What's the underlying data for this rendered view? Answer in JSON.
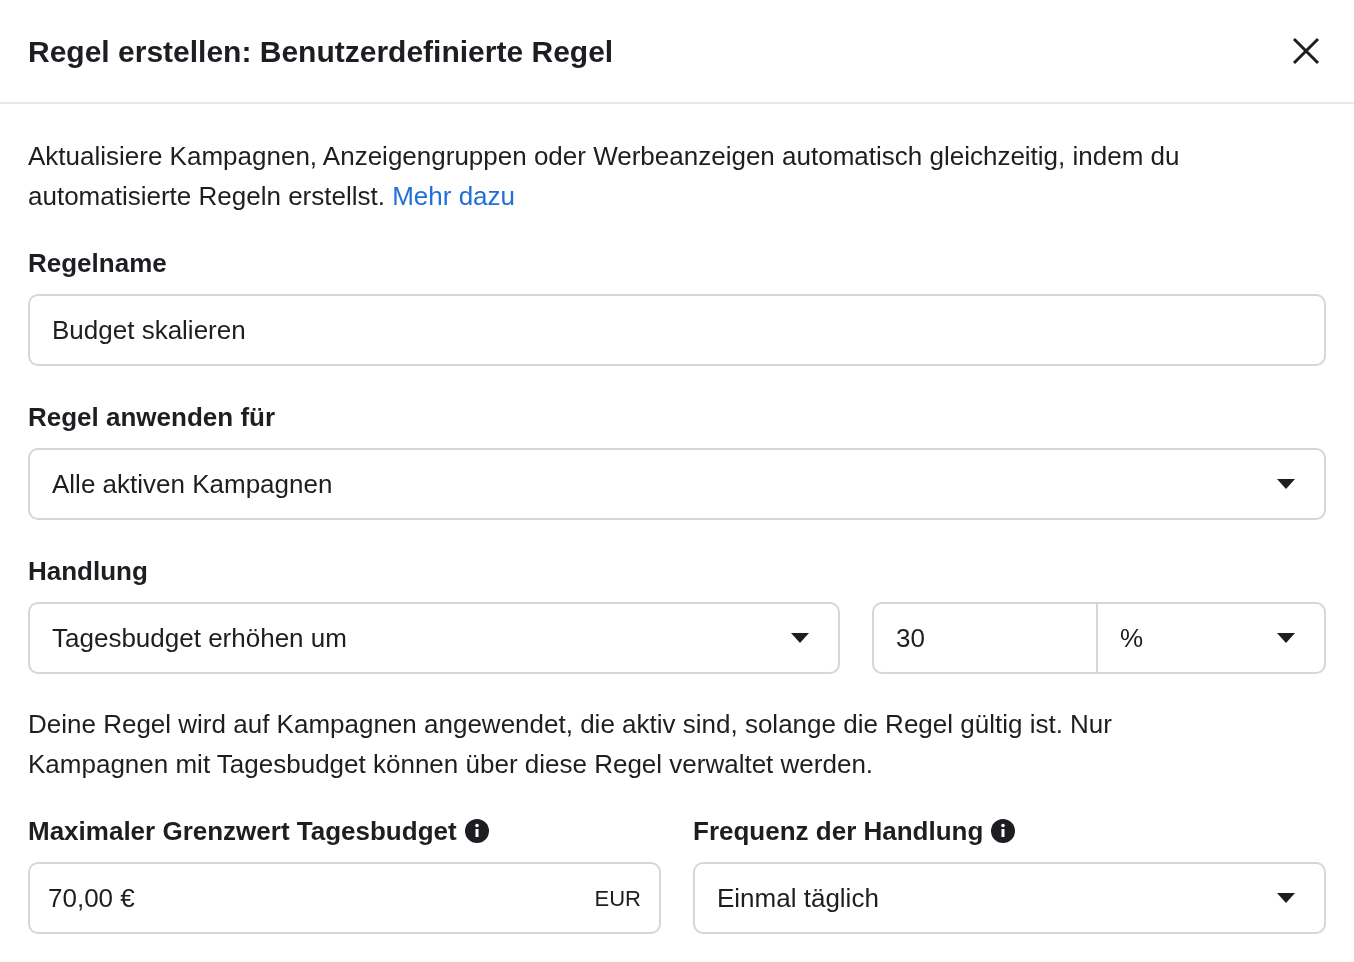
{
  "dialog": {
    "title": "Regel erstellen: Benutzerdefinierte Regel"
  },
  "intro": {
    "text": "Aktualisiere Kampagnen, Anzeigengruppen oder Werbeanzeigen automatisch gleichzeitig, indem du automatisierte Regeln erstellst.",
    "link": "Mehr dazu"
  },
  "rule_name": {
    "label": "Regelname",
    "value": "Budget skalieren"
  },
  "apply_to": {
    "label": "Regel anwenden für",
    "value": "Alle aktiven Kampagnen"
  },
  "action": {
    "label": "Handlung",
    "value": "Tagesbudget erhöhen um",
    "amount": "30",
    "unit": "%"
  },
  "note": "Deine Regel wird auf Kampagnen angewendet, die aktiv sind, solange die Regel gültig ist. Nur Kampagnen mit Tagesbudget können über diese Regel verwaltet werden.",
  "max_budget": {
    "label": "Maximaler Grenzwert Tagesbudget",
    "value": "70,00 €",
    "currency": "EUR"
  },
  "frequency": {
    "label": "Frequenz der Handlung",
    "value": "Einmal täglich"
  }
}
